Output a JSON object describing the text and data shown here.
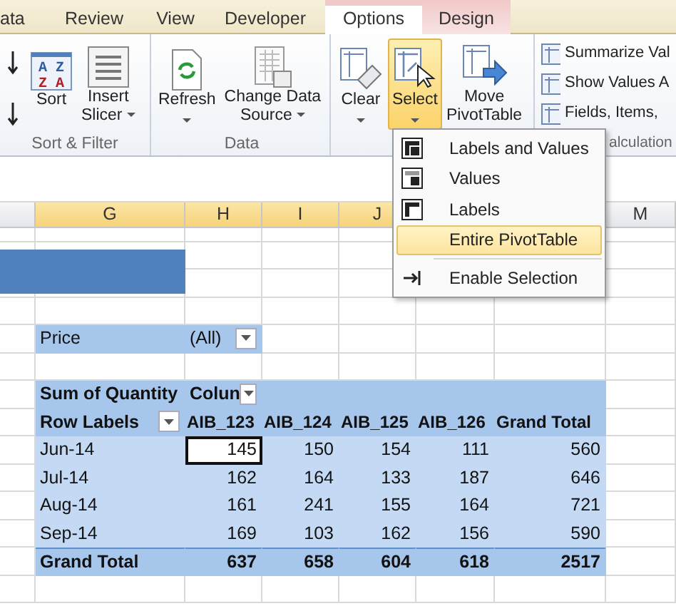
{
  "ribbon_tabs": [
    {
      "label": "ata",
      "selected": false,
      "contextual": false
    },
    {
      "label": "Review",
      "selected": false,
      "contextual": false
    },
    {
      "label": "View",
      "selected": false,
      "contextual": false
    },
    {
      "label": "Developer",
      "selected": false,
      "contextual": false
    },
    {
      "label": "Options",
      "selected": true,
      "contextual": true
    },
    {
      "label": "Design",
      "selected": false,
      "contextual": true
    }
  ],
  "ribbon_groups": [
    {
      "label": "Sort & Filter",
      "buttons": [
        {
          "kind": "sort-arrows"
        },
        {
          "kind": "sort",
          "lines": [
            "Sort"
          ],
          "icon_letters": [
            "A Z",
            "Z A"
          ],
          "dropdown": false,
          "pressed": false
        },
        {
          "kind": "slicer",
          "lines": [
            "Insert",
            "Slicer"
          ],
          "dropdown": true,
          "pressed": false
        }
      ]
    },
    {
      "label": "Data",
      "buttons": [
        {
          "kind": "refresh",
          "lines": [
            "Refresh"
          ],
          "dropdown": true,
          "pressed": false
        },
        {
          "kind": "source",
          "lines": [
            "Change Data",
            "Source"
          ],
          "dropdown": true,
          "pressed": false
        }
      ]
    },
    {
      "buttons": [
        {
          "kind": "clear",
          "lines": [
            "Clear"
          ],
          "dropdown": true,
          "pressed": false
        },
        {
          "kind": "select",
          "lines": [
            "Select"
          ],
          "dropdown": true,
          "pressed": true
        },
        {
          "kind": "move",
          "lines": [
            "Move",
            "PivotTable"
          ],
          "dropdown": false,
          "pressed": false
        }
      ]
    },
    {
      "label": "alculation",
      "small_buttons": [
        {
          "label": "Summarize Val"
        },
        {
          "label": "Show Values A"
        },
        {
          "label": "Fields, Items,"
        }
      ]
    }
  ],
  "select_menu": [
    {
      "label": "Labels and Values",
      "selected": false,
      "kind": "both"
    },
    {
      "label": "Values",
      "selected": false,
      "kind": "values"
    },
    {
      "label": "Labels",
      "selected": false,
      "kind": "labels"
    },
    {
      "label": "Entire PivotTable",
      "selected": true,
      "kind": "none"
    },
    {
      "kind": "separator"
    },
    {
      "label": "Enable Selection",
      "selected": false,
      "kind": "enable"
    }
  ],
  "column_headers": [
    {
      "label": "G",
      "highlighted": true
    },
    {
      "label": "H",
      "highlighted": true
    },
    {
      "label": "I",
      "highlighted": true
    },
    {
      "label": "J",
      "highlighted": true
    },
    {
      "label": "M",
      "highlighted": false
    }
  ],
  "report_filter": {
    "field": "Price",
    "value": "(All)"
  },
  "pivot": {
    "values_label": "Sum of Quantity",
    "column_labels": "Colun",
    "row_labels": "Row Labels",
    "columns": [
      "AIB_123",
      "AIB_124",
      "AIB_125",
      "AIB_126",
      "Grand Total"
    ],
    "rows": [
      {
        "label": "Jun-14",
        "cells": [
          {
            "value": "145",
            "active": true
          },
          {
            "value": "150",
            "active": false
          },
          {
            "value": "154",
            "active": false
          },
          {
            "value": "111",
            "active": false
          },
          {
            "value": "560",
            "active": false
          }
        ]
      },
      {
        "label": "Jul-14",
        "cells": [
          {
            "value": "162",
            "active": false
          },
          {
            "value": "164",
            "active": false
          },
          {
            "value": "133",
            "active": false
          },
          {
            "value": "187",
            "active": false
          },
          {
            "value": "646",
            "active": false
          }
        ]
      },
      {
        "label": "Aug-14",
        "cells": [
          {
            "value": "161",
            "active": false
          },
          {
            "value": "241",
            "active": false
          },
          {
            "value": "155",
            "active": false
          },
          {
            "value": "164",
            "active": false
          },
          {
            "value": "721",
            "active": false
          }
        ]
      },
      {
        "label": "Sep-14",
        "cells": [
          {
            "value": "169",
            "active": false
          },
          {
            "value": "103",
            "active": false
          },
          {
            "value": "162",
            "active": false
          },
          {
            "value": "156",
            "active": false
          },
          {
            "value": "590",
            "active": false
          }
        ]
      }
    ],
    "grand_total": {
      "label": "Grand Total",
      "values": [
        "637",
        "658",
        "604",
        "618",
        "2517"
      ]
    }
  }
}
